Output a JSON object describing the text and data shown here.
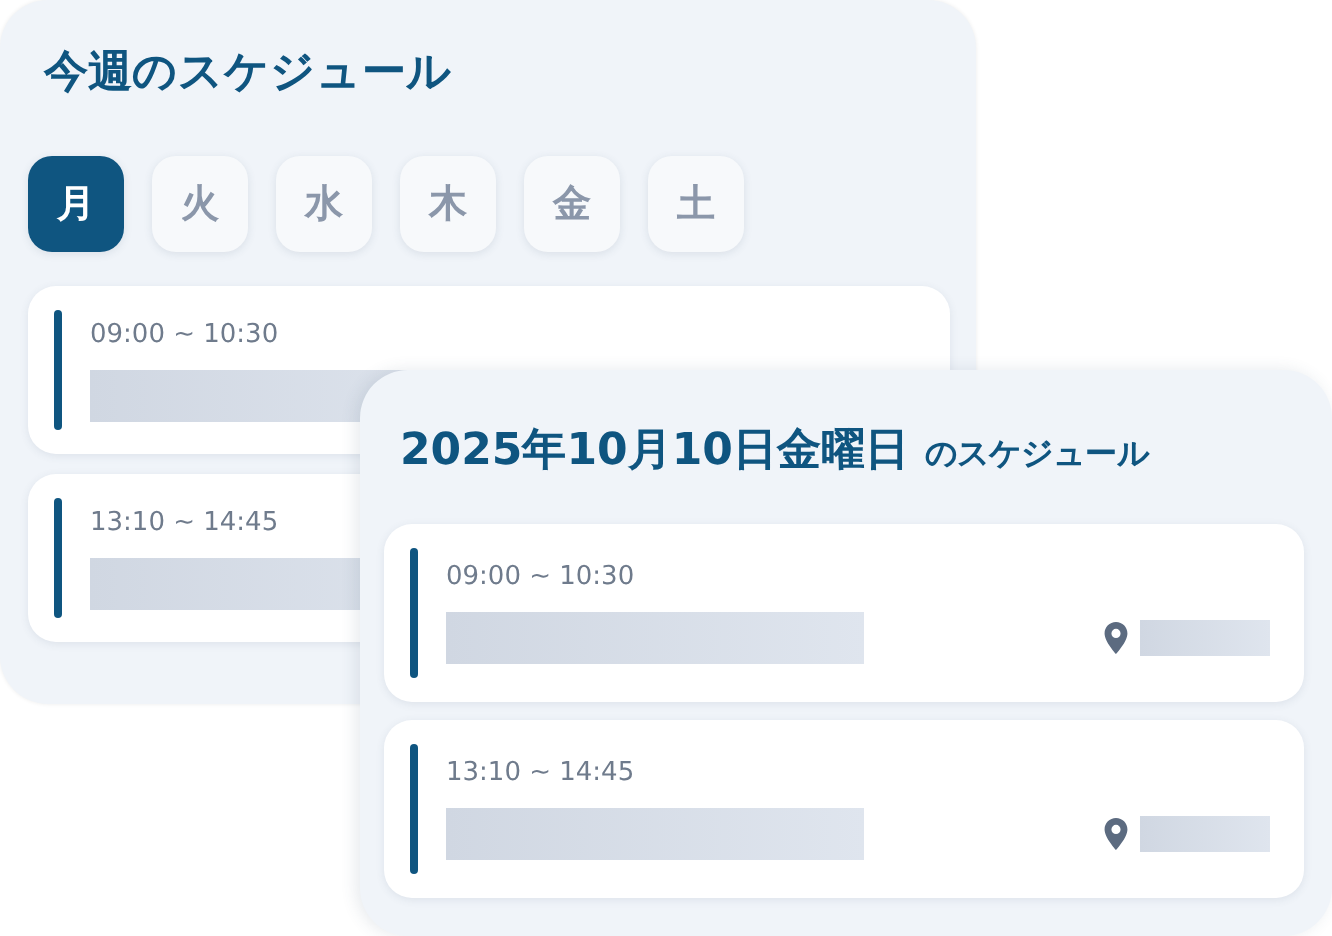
{
  "week_panel": {
    "title": "今週のスケジュール",
    "days": [
      {
        "label": "月",
        "selected": true
      },
      {
        "label": "火",
        "selected": false
      },
      {
        "label": "水",
        "selected": false
      },
      {
        "label": "木",
        "selected": false
      },
      {
        "label": "金",
        "selected": false
      },
      {
        "label": "土",
        "selected": false
      }
    ],
    "events": [
      {
        "time": "09:00 ~ 10:30"
      },
      {
        "time": "13:10 ~ 14:45"
      }
    ]
  },
  "day_panel": {
    "title_date": "2025年10月10日金曜日",
    "title_suffix": "のスケジュール",
    "events": [
      {
        "time": "09:00 ~ 10:30"
      },
      {
        "time": "13:10 ~ 14:45"
      }
    ]
  }
}
